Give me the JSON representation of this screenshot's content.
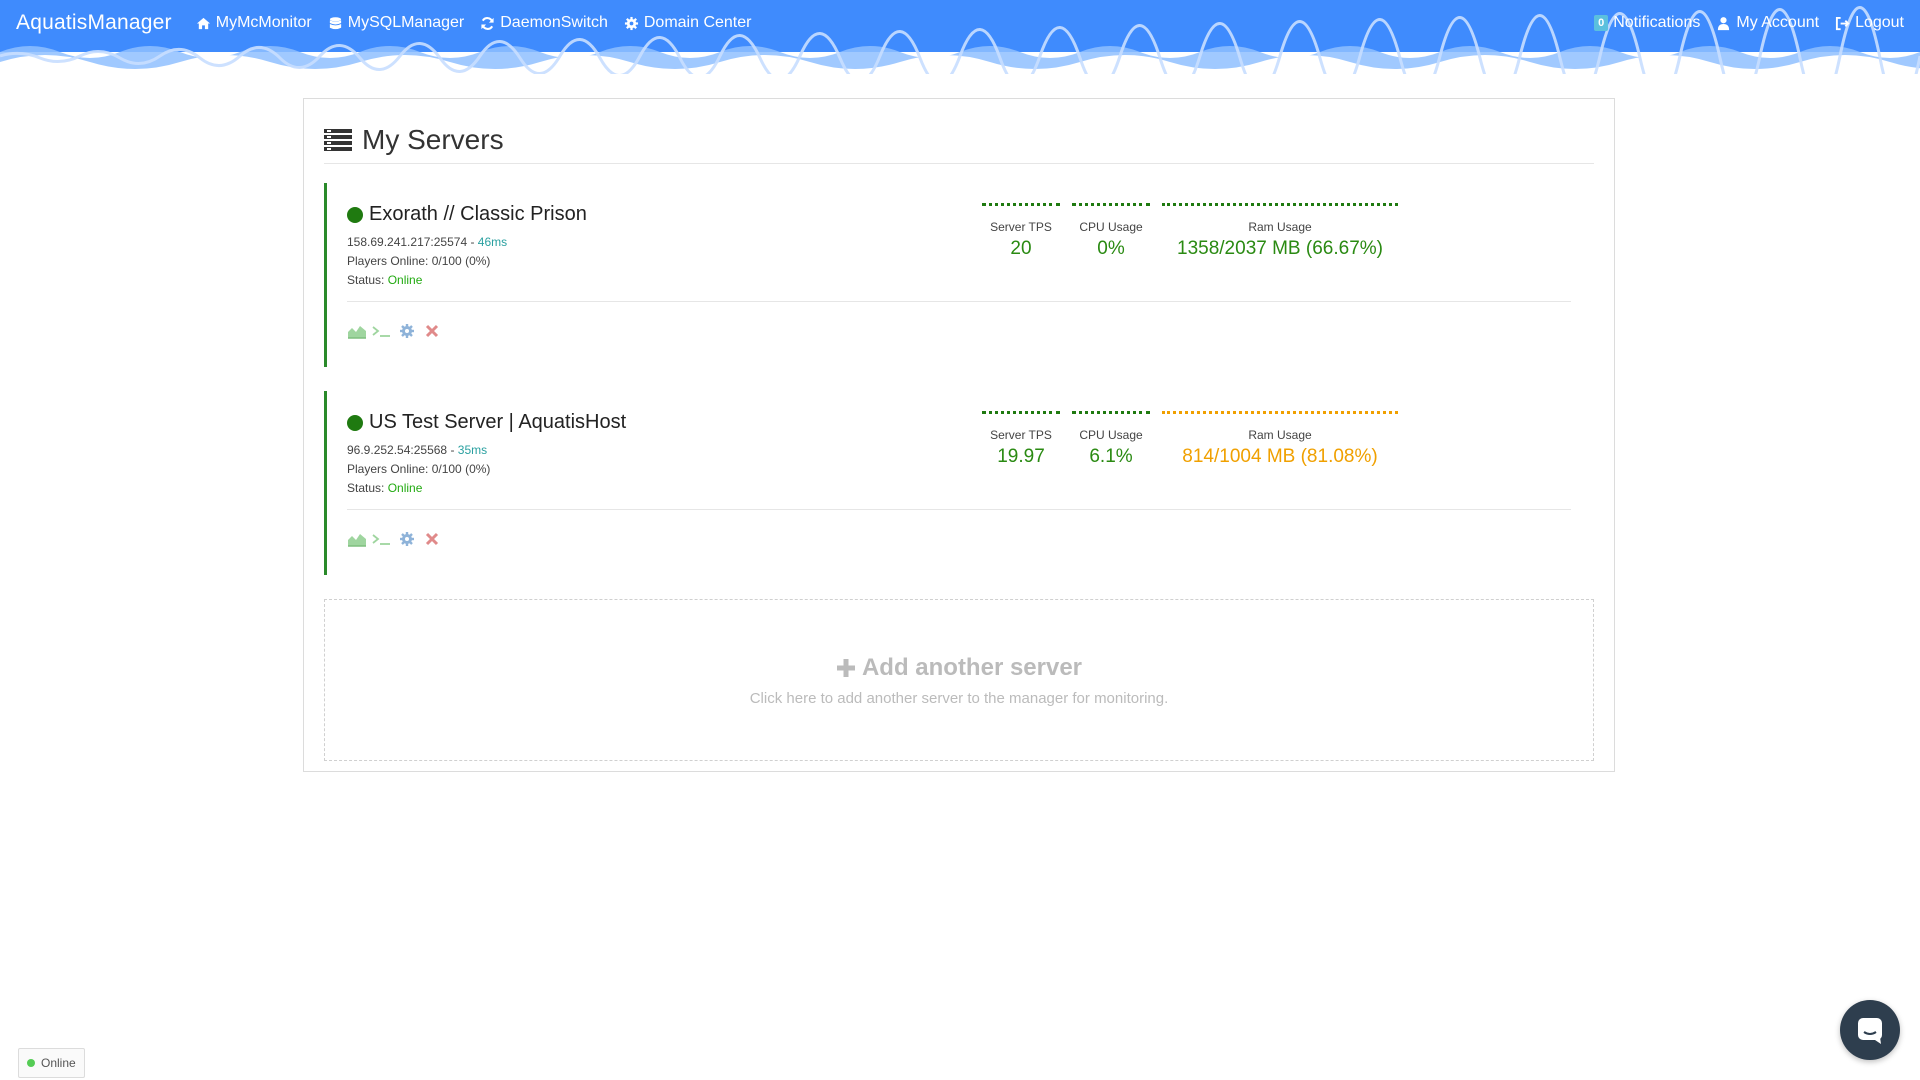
{
  "nav": {
    "brand": "AquatisManager",
    "links": [
      {
        "label": "MyMcMonitor",
        "icon": "home-icon"
      },
      {
        "label": "MySQLManager",
        "icon": "database-icon"
      },
      {
        "label": "DaemonSwitch",
        "icon": "refresh-icon"
      },
      {
        "label": "Domain Center",
        "icon": "gear-icon"
      }
    ],
    "notifications": {
      "count": "0",
      "label": "Notifications"
    },
    "account": {
      "label": "My Account",
      "icon": "user-icon"
    },
    "logout": {
      "label": "Logout",
      "icon": "logout-icon"
    }
  },
  "panel": {
    "title": "My Servers",
    "icon": "server-list-icon"
  },
  "servers": [
    {
      "name": "Exorath // Classic Prison",
      "address": "158.69.241.217:25574",
      "ping": "46ms",
      "players": "Players Online: 0/100 (0%)",
      "status_label": "Status:",
      "status": "Online",
      "tps_label": "Server TPS",
      "tps": "20",
      "cpu_label": "CPU Usage",
      "cpu": "0%",
      "ram_label": "Ram Usage",
      "ram": "1358/2037 MB (66.67%)",
      "ram_state": "ok"
    },
    {
      "name": "US Test Server | AquatisHost",
      "address": "96.9.252.54:25568",
      "ping": "35ms",
      "players": "Players Online: 0/100 (0%)",
      "status_label": "Status:",
      "status": "Online",
      "tps_label": "Server TPS",
      "tps": "19.97",
      "cpu_label": "CPU Usage",
      "cpu": "6.1%",
      "ram_label": "Ram Usage",
      "ram": "814/1004 MB (81.08%)",
      "ram_state": "warn"
    }
  ],
  "actions": [
    "chart-icon",
    "terminal-icon",
    "settings-icon",
    "delete-icon"
  ],
  "add_server": {
    "title": "Add another server",
    "subtitle": "Click here to add another server to the manager for monitoring."
  },
  "footer": {
    "online_label": "Online"
  },
  "colors": {
    "navbar": "#3f8bfd",
    "online": "#1f7a10",
    "warn": "#f0a000",
    "server_border": "#2a8a2a"
  }
}
